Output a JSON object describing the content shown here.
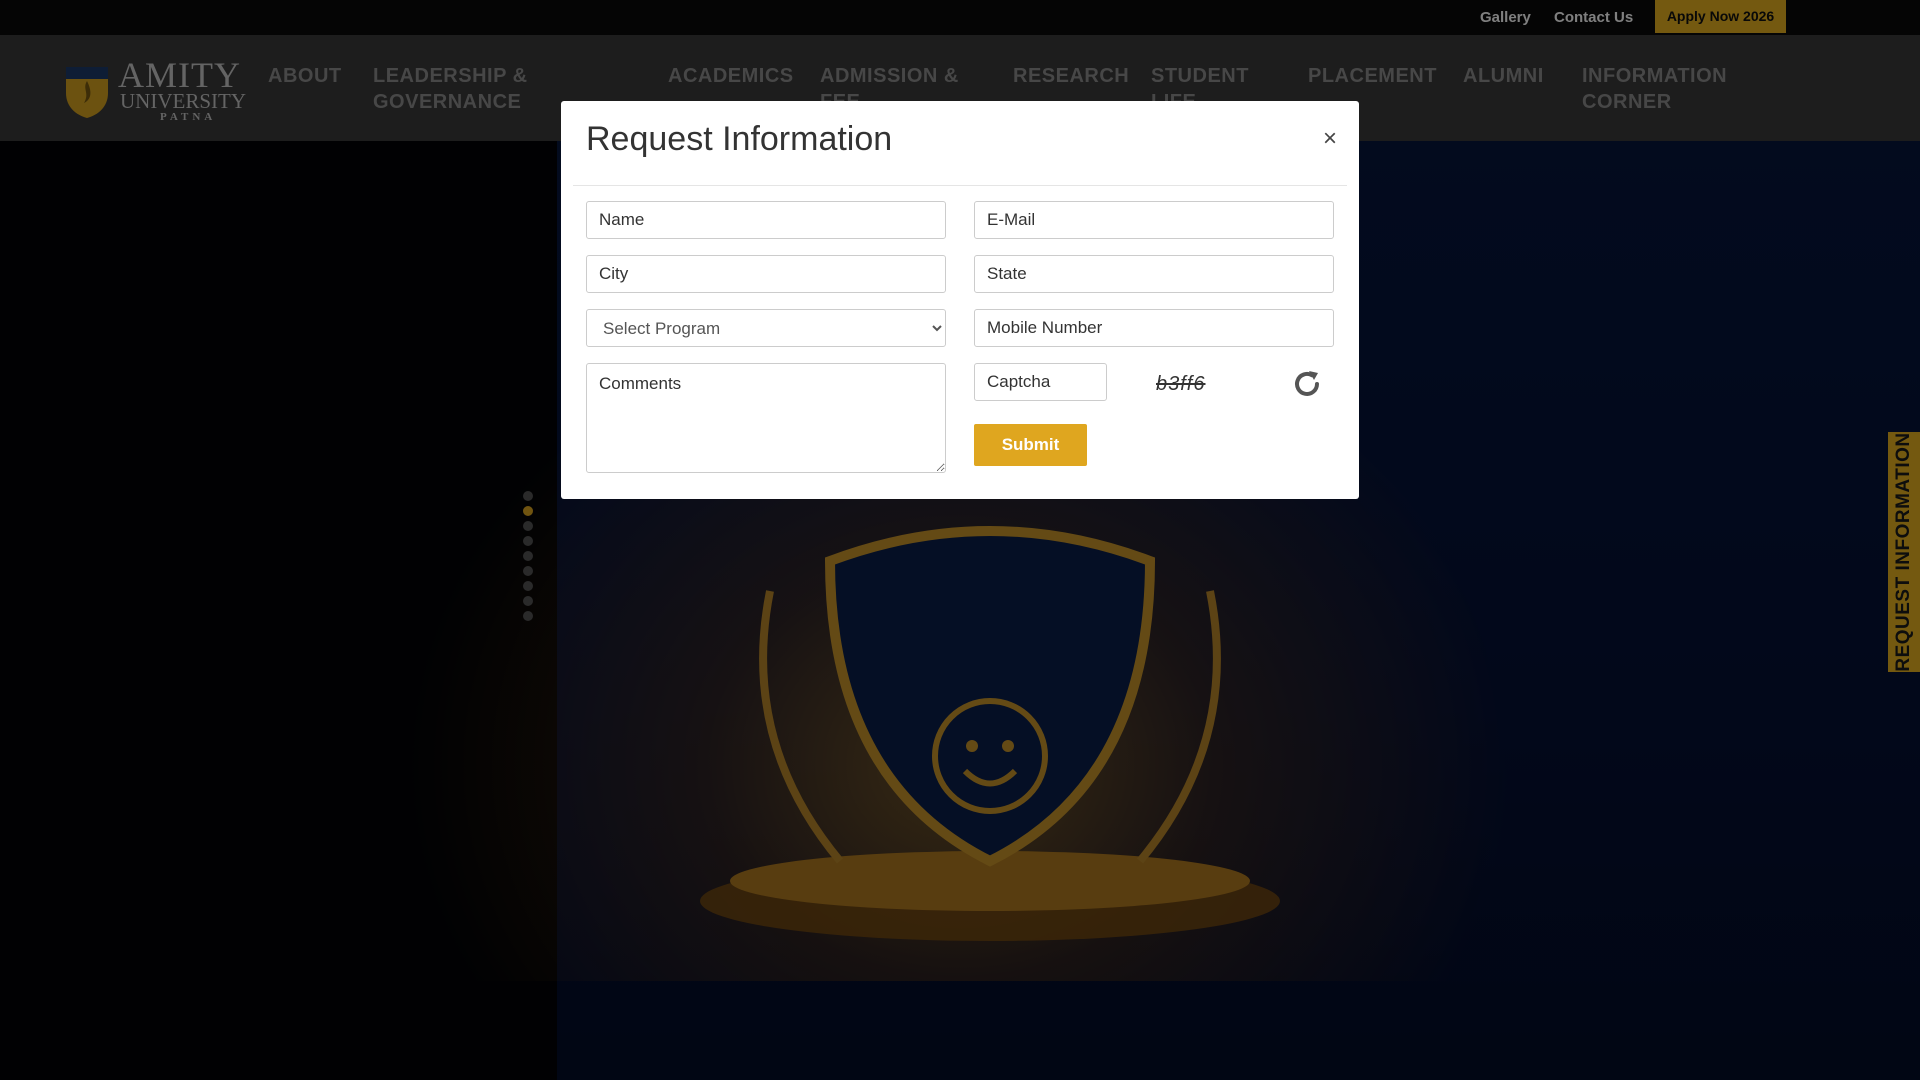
{
  "topbar": {
    "gallery": "Gallery",
    "contact": "Contact Us",
    "apply": "Apply Now 2026"
  },
  "logo": {
    "name": "AMITY",
    "sub": "UNIVERSITY",
    "city": "PATNA"
  },
  "nav": {
    "items": [
      "ABOUT",
      "LEADERSHIP & GOVERNANCE",
      "ACADEMICS",
      "ADMISSION & FEE",
      "RESEARCH",
      "STUDENT LIFE",
      "PLACEMENT",
      "ALUMNI",
      "INFORMATION CORNER"
    ]
  },
  "hero": {
    "slide_count": 9,
    "active_slide": 2
  },
  "side_tab": {
    "label": "REQUEST INFORMATION"
  },
  "modal": {
    "title": "Request Information",
    "close": "×",
    "fields": {
      "name": "Name",
      "email": "E-Mail",
      "city": "City",
      "state": "State",
      "program": "Select Program",
      "mobile": "Mobile Number",
      "comments": "Comments",
      "captcha": "Captcha"
    },
    "captcha_code": "b3ff6",
    "submit": "Submit"
  },
  "colors": {
    "accent": "#e8b320",
    "submit": "#dfa61f",
    "header_bg": "#3a3a3a",
    "topbar_bg": "#0b0b0b"
  },
  "icons": {
    "close": "close-icon",
    "refresh": "refresh-icon"
  }
}
